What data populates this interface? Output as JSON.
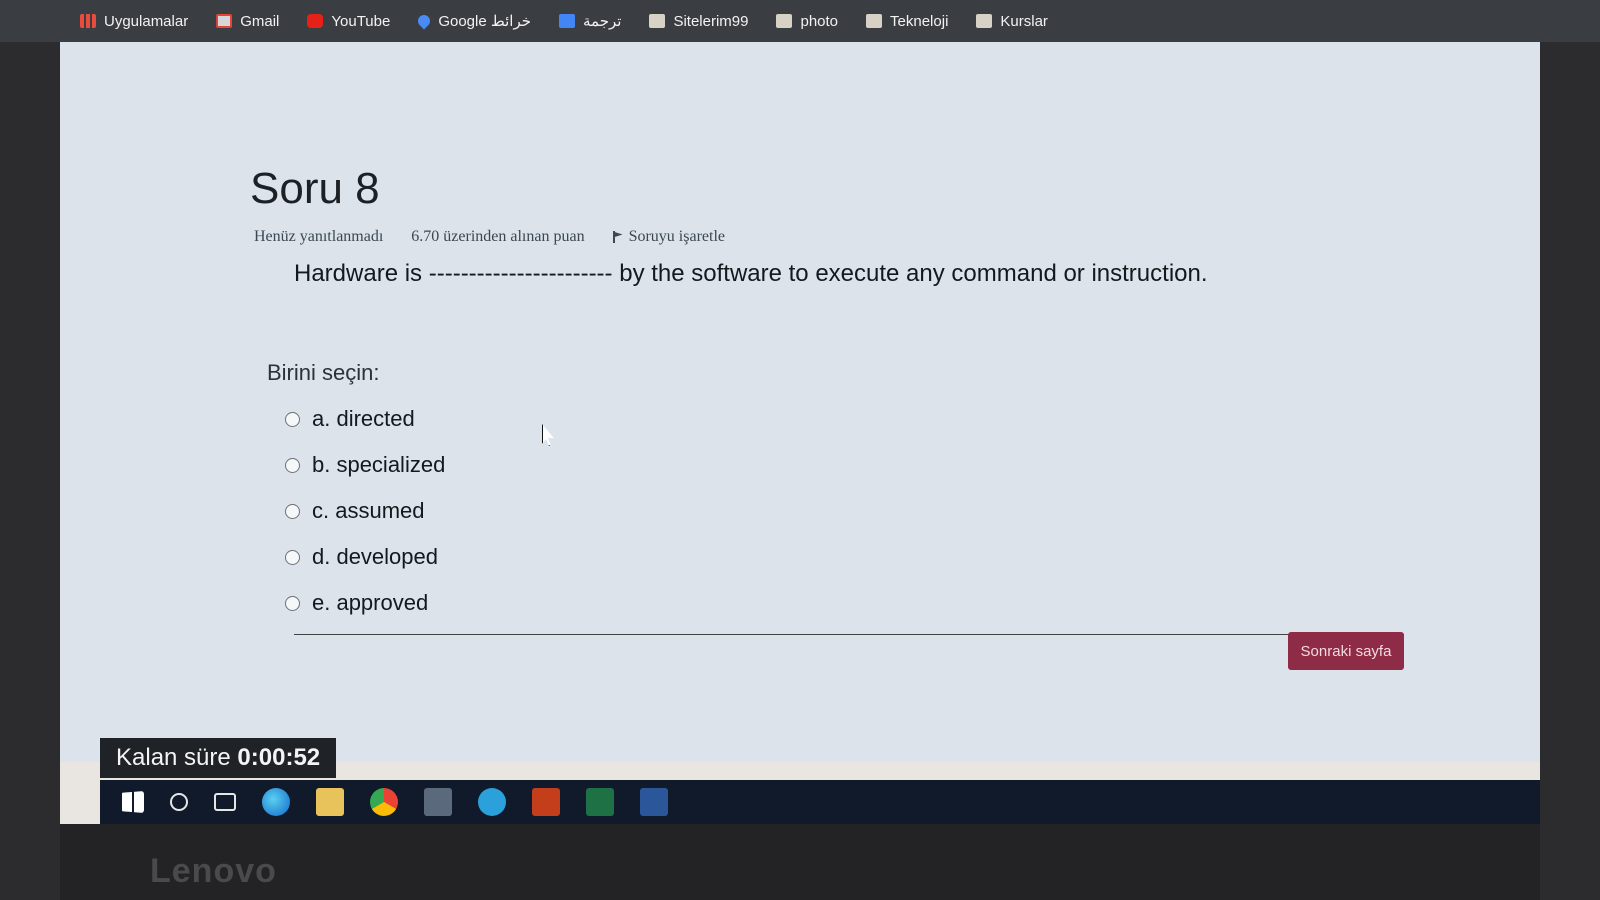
{
  "bookmarks": {
    "items": [
      {
        "label": "Uygulamalar",
        "icon": "apps-grid-icon"
      },
      {
        "label": "Gmail",
        "icon": "gmail-icon"
      },
      {
        "label": "YouTube",
        "icon": "youtube-icon"
      },
      {
        "label": "Google خرائط",
        "icon": "google-maps-icon"
      },
      {
        "label": "ترجمة",
        "icon": "google-translate-icon"
      },
      {
        "label": "Sitelerim99",
        "icon": "folder-icon"
      },
      {
        "label": "photo",
        "icon": "folder-icon"
      },
      {
        "label": "Tekneloji",
        "icon": "folder-icon"
      },
      {
        "label": "Kurslar",
        "icon": "folder-icon"
      }
    ]
  },
  "question": {
    "title": "Soru 8",
    "status": "Henüz yanıtlanmadı",
    "points": "6.70 üzerinden alınan puan",
    "flag_label": "Soruyu işaretle",
    "text_before": "Hardware is",
    "blank": "-----------------------",
    "text_after": "by the software to execute any command or instruction.",
    "prompt": "Birini seçin:",
    "options": [
      {
        "label": "a. directed"
      },
      {
        "label": "b. specialized"
      },
      {
        "label": "c. assumed"
      },
      {
        "label": "d. developed"
      },
      {
        "label": "e. approved"
      }
    ]
  },
  "navigation": {
    "next_label": "Sonraki sayfa"
  },
  "timer": {
    "label": "Kalan süre",
    "value": "0:00:52"
  },
  "device": {
    "brand": "Lenovo"
  },
  "colors": {
    "next_button": "#8e2b46",
    "taskbar": "#101a2b",
    "page_background": "#dce3ea"
  }
}
